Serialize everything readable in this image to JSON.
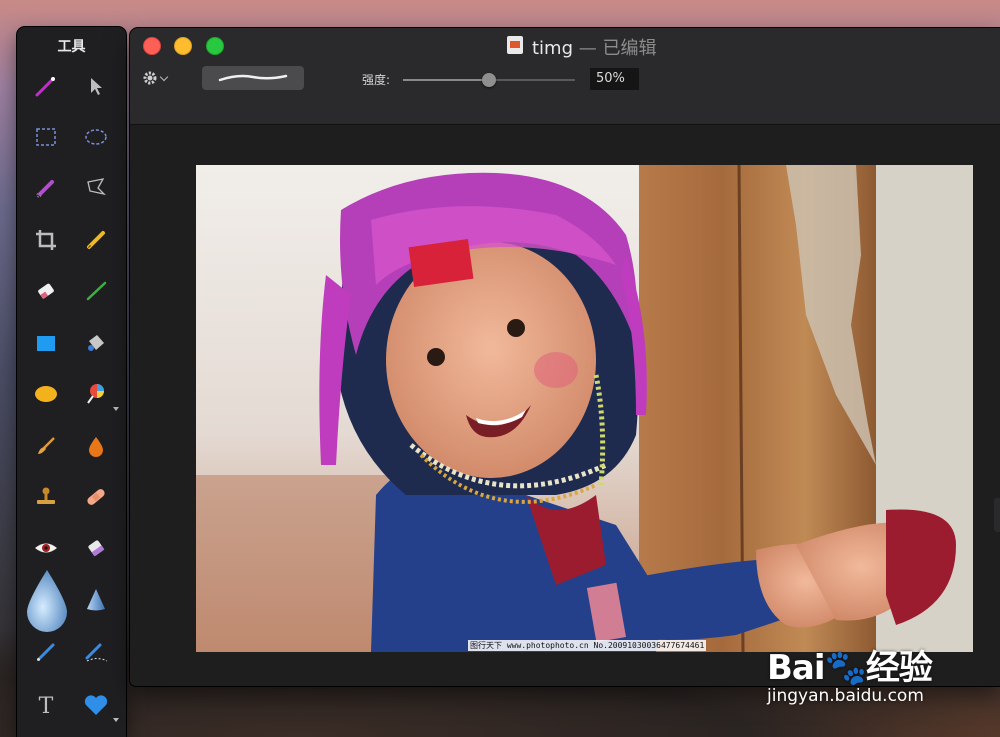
{
  "tools_panel": {
    "title": "工具",
    "tools": [
      {
        "name": "magic-wand-icon"
      },
      {
        "name": "arrow-select-icon"
      },
      {
        "name": "rect-select-icon"
      },
      {
        "name": "ellipse-select-icon"
      },
      {
        "name": "color-pick-icon"
      },
      {
        "name": "lasso-icon"
      },
      {
        "name": "crop-icon"
      },
      {
        "name": "pencil-icon"
      },
      {
        "name": "eraser-icon"
      },
      {
        "name": "pen-icon"
      },
      {
        "name": "rectangle-shape-icon"
      },
      {
        "name": "paint-bucket-icon"
      },
      {
        "name": "ellipse-shape-icon"
      },
      {
        "name": "gradient-lollipop-icon"
      },
      {
        "name": "smudge-brush-icon"
      },
      {
        "name": "burn-drop-icon"
      },
      {
        "name": "clone-stamp-icon"
      },
      {
        "name": "heal-bandage-icon"
      },
      {
        "name": "red-eye-icon"
      },
      {
        "name": "sponge-eraser-icon"
      },
      {
        "name": "water-drop-icon"
      },
      {
        "name": "cone-sharpen-icon"
      },
      {
        "name": "brush-icon"
      },
      {
        "name": "vector-pen-icon"
      },
      {
        "name": "text-tool-icon"
      },
      {
        "name": "heart-shape-icon"
      }
    ]
  },
  "window": {
    "title": "timg",
    "edited_suffix": "— 已编辑",
    "toolbar": {
      "strength_label": "强度:",
      "strength_value": "50%",
      "strength_fraction": 0.5
    },
    "image_caption": "图行天下 www.photophoto.cn  No.20091030036477674461"
  },
  "watermark": {
    "brand": "Bai🐾经验",
    "url": "jingyan.baidu.com"
  },
  "colors": {
    "close": "#fe5f57",
    "minimize": "#febc2e",
    "maximize": "#28c840"
  }
}
